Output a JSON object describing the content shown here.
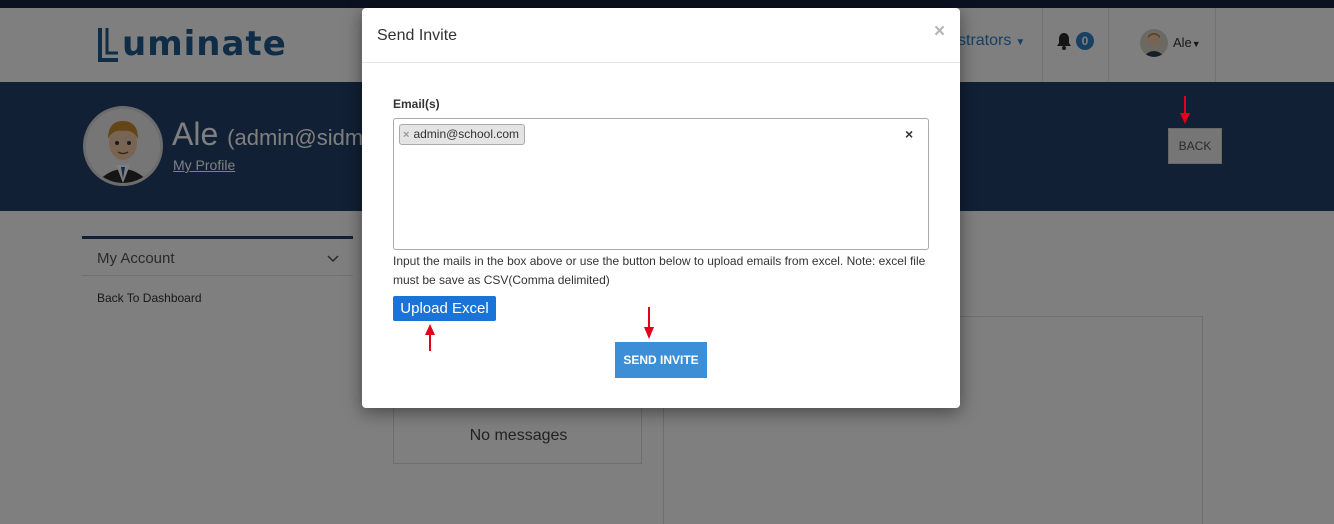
{
  "navbar": {
    "logo_text": "uminate",
    "admin_menu": "strators",
    "notification_count": "0",
    "user_name": "Ale"
  },
  "profile": {
    "name": "Ale",
    "email": "(admin@sidmac",
    "my_profile_link": "My Profile",
    "back_label": "BACK"
  },
  "sidebar": {
    "header": "My Account",
    "items": [
      {
        "label": "Back To Dashboard"
      }
    ]
  },
  "messages": {
    "empty_text": "No messages"
  },
  "modal": {
    "title": "Send Invite",
    "close_symbol": "×",
    "email_label": "Email(s)",
    "tags": [
      {
        "remove_symbol": "×",
        "text": "admin@school.com"
      }
    ],
    "clear_symbol": "×",
    "help_text": "Input the mails in the box above or use the button below to upload emails from excel. Note: excel file must be save as CSV(Comma delimited)",
    "upload_label": "Upload Excel",
    "send_label": "SEND INVITE"
  },
  "colors": {
    "navy": "#22406a",
    "accent_blue": "#1a73d6",
    "annotation_red": "#e3001b"
  }
}
